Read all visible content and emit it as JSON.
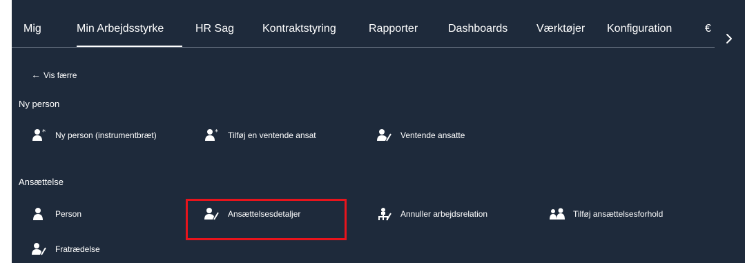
{
  "tabs": [
    {
      "label": "Mig",
      "active": false
    },
    {
      "label": "Min Arbejdsstyrke",
      "active": true
    },
    {
      "label": "HR Sag",
      "active": false
    },
    {
      "label": "Kontraktstyring",
      "active": false
    },
    {
      "label": "Rapporter",
      "active": false
    },
    {
      "label": "Dashboards",
      "active": false
    },
    {
      "label": "Værktøjer",
      "active": false
    },
    {
      "label": "Konfiguration",
      "active": false
    }
  ],
  "show_less": "Vis færre",
  "sections": [
    {
      "title": "Ny person",
      "items": [
        {
          "label": "Ny person (instrumentbræt)",
          "icon": "person-add-icon"
        },
        {
          "label": "Tilføj en ventende ansat",
          "icon": "person-add-icon"
        },
        {
          "label": "Ventende ansatte",
          "icon": "person-edit-icon"
        }
      ]
    },
    {
      "title": "Ansættelse",
      "items": [
        {
          "label": "Person",
          "icon": "person-icon"
        },
        {
          "label": "Ansættelsesdetaljer",
          "icon": "person-edit-icon",
          "highlighted": true
        },
        {
          "label": "Annuller arbejdsrelation",
          "icon": "org-cancel-icon"
        },
        {
          "label": "Tilføj ansættelsesforhold",
          "icon": "two-persons-icon"
        },
        {
          "label": "Fratrædelse",
          "icon": "person-edit-icon"
        }
      ]
    }
  ],
  "colors": {
    "background": "#1e2a3b",
    "highlight": "#e8141c",
    "text": "#ffffff"
  }
}
